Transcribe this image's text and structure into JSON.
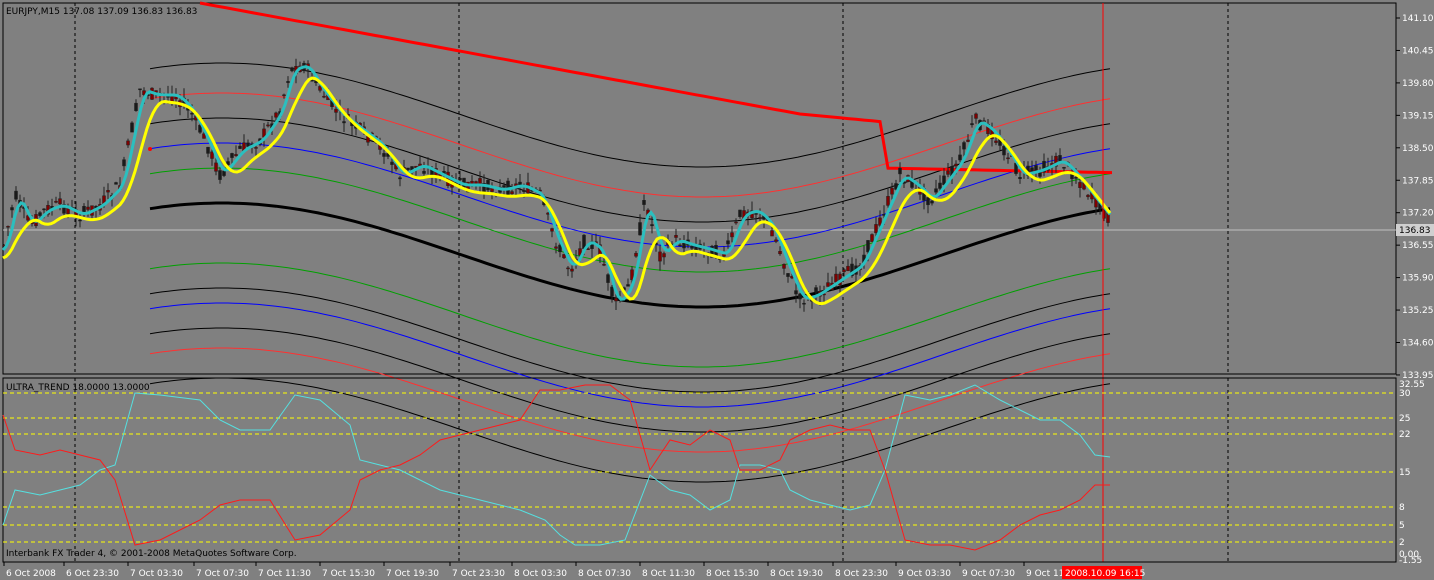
{
  "main": {
    "symbol_info": "EURJPY,M15  137.08 137.09 136.83 136.83",
    "current_price_label": "136.83",
    "price_axis": [
      "141.10",
      "140.45",
      "139.80",
      "139.15",
      "138.50",
      "137.85",
      "137.20",
      "136.55",
      "135.90",
      "135.25",
      "134.60",
      "133.95"
    ],
    "time_axis": [
      "6 Oct 2008",
      "6 Oct 23:30",
      "7 Oct 03:30",
      "7 Oct 07:30",
      "7 Oct 11:30",
      "7 Oct 15:30",
      "7 Oct 19:30",
      "7 Oct 23:30",
      "8 Oct 03:30",
      "8 Oct 07:30",
      "8 Oct 11:30",
      "8 Oct 15:30",
      "8 Oct 19:30",
      "8 Oct 23:30",
      "9 Oct 03:30",
      "9 Oct 07:30",
      "9 Oct 11"
    ],
    "cursor_time_label": "2008.10.09 16:15"
  },
  "indicator": {
    "title": "ULTRA_TREND 18.0000 13.0000",
    "scale_labels": [
      "32.55",
      "30",
      "25",
      "22",
      "15",
      "8",
      "5",
      "2",
      "0.00",
      "-1.55"
    ]
  },
  "footer": {
    "copyright": "Interbank FX Trader 4, © 2001-2008 MetaQuotes Software Corp."
  },
  "colors": {
    "background": "#808080",
    "frame": "#000000",
    "price_line": "#c0c0c0",
    "cursor_line": "#ff0000",
    "ma_fast": "#2bbfbf",
    "ma_slow": "#ffff00",
    "trend_center": "#000000",
    "ma_long": "#ff0000",
    "level_line": "#ffff00",
    "bull_line": "#55e0e0",
    "bear_line": "#ff1a1a"
  }
}
